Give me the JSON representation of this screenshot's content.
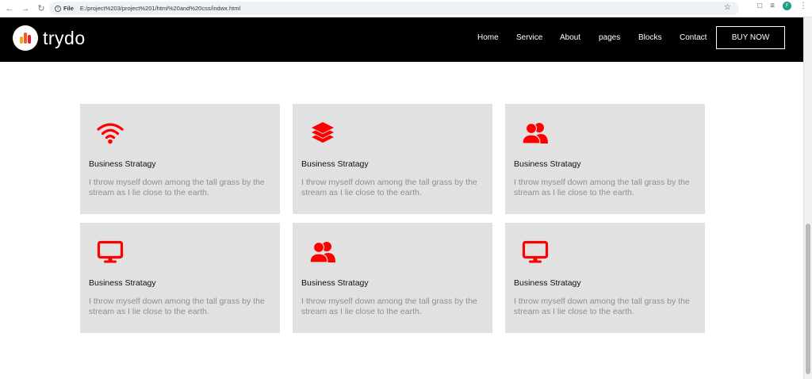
{
  "browser": {
    "file_label": "File",
    "url": "E:/project%203/project%201/html%20and%20css/indwx.html",
    "avatar_letter": "F"
  },
  "header": {
    "logo_text": "trydo",
    "nav": [
      "Home",
      "Service",
      "About",
      "pages",
      "Blocks",
      "Contact"
    ],
    "cta_label": "BUY NOW"
  },
  "colors": {
    "accent": "#ff0000",
    "header_bg": "#000000",
    "card_bg": "#e1e1e1",
    "desc_text": "#8f8f8f"
  },
  "cards": [
    {
      "icon": "wifi-icon",
      "title": "Business Stratagy",
      "desc": "I throw myself down among the tall grass by the stream as I lie close to the earth."
    },
    {
      "icon": "layers-icon",
      "title": "Business Stratagy",
      "desc": "I throw myself down among the tall grass by the stream as I lie close to the earth."
    },
    {
      "icon": "users-icon",
      "title": "Business Stratagy",
      "desc": "I throw myself down among the tall grass by the stream as I lie close to the earth."
    },
    {
      "icon": "monitor-icon",
      "title": "Business Stratagy",
      "desc": "I throw myself down among the tall grass by the stream as I lie close to the earth."
    },
    {
      "icon": "users-icon",
      "title": "Business Stratagy",
      "desc": "I throw myself down among the tall grass by the stream as I lie close to the earth."
    },
    {
      "icon": "monitor-icon",
      "title": "Business Stratagy",
      "desc": "I throw myself down among the tall grass by the stream as I lie close to the earth."
    }
  ]
}
